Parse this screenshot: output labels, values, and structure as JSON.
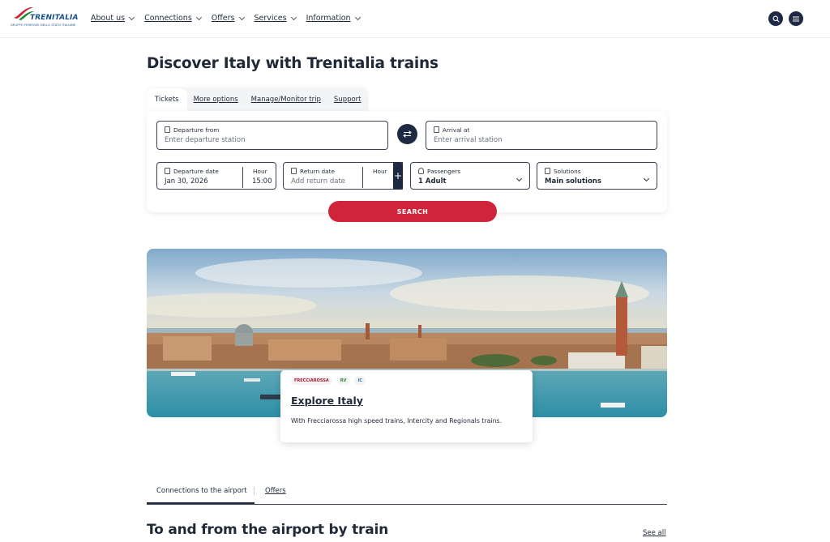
{
  "header": {
    "logo_text": "TRENITALIA",
    "logo_subtext": "GRUPPO FERROVIE DELLO STATO ITALIANE",
    "nav": [
      {
        "label": "About us"
      },
      {
        "label": "Connections"
      },
      {
        "label": "Offers"
      },
      {
        "label": "Services"
      },
      {
        "label": "Information"
      }
    ],
    "icons": [
      "search-icon",
      "menu-icon"
    ]
  },
  "page_title": "Discover Italy with Trenitalia trains",
  "booking": {
    "tabs": [
      "Tickets",
      "More options",
      "Manage/Monitor trip",
      "Support"
    ],
    "active_tab": "Tickets",
    "departure": {
      "label": "Departure from",
      "placeholder": "Enter departure station"
    },
    "arrival": {
      "label": "Arrival at",
      "placeholder": "Enter arrival station"
    },
    "departure_date": {
      "label": "Departure date",
      "value": "Jan 30, 2026",
      "hour_label": "Hour",
      "hour_value": "15:00"
    },
    "return_date": {
      "label": "Return date",
      "placeholder": "Add return date",
      "hour_label": "Hour"
    },
    "add_symbol": "+",
    "passengers": {
      "label": "Passengers",
      "value": "1 Adult"
    },
    "solutions": {
      "label": "Solutions",
      "value": "Main solutions"
    },
    "search_label": "SEARCH"
  },
  "hero": {
    "badges": [
      "FRECCIAROSSA",
      "RV",
      "IC"
    ],
    "title": "Explore Italy",
    "text": "With Frecciarossa high speed trains, Intercity and Regionals trains."
  },
  "bottom": {
    "tabs": [
      "Connections to the airport",
      "Offers"
    ],
    "section_title": "To and from the airport by train",
    "see_all": "See all"
  },
  "colors": {
    "primary_dark": "#1e2a44",
    "accent_red": "#d0243a",
    "logo_blue": "#1a4f8f"
  }
}
